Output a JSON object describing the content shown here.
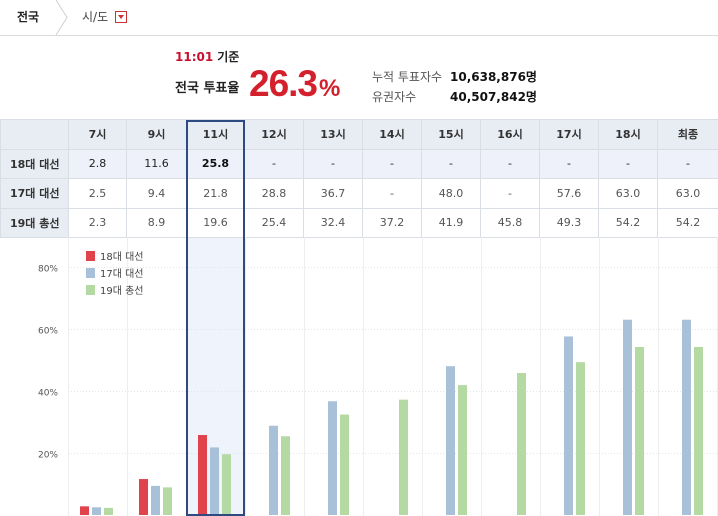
{
  "breadcrumb": {
    "national_label": "전국",
    "region_label": "시/도"
  },
  "summary": {
    "time": "11:01",
    "time_suffix": "기준",
    "turnout_label": "전국 투표율",
    "turnout_value": "26.3",
    "turnout_unit": "%",
    "cumulative_label": "누적 투표자수",
    "cumulative_value": "10,638,876명",
    "eligible_label": "유권자수",
    "eligible_value": "40,507,842명"
  },
  "table": {
    "columns": [
      "7시",
      "9시",
      "11시",
      "12시",
      "13시",
      "14시",
      "15시",
      "16시",
      "17시",
      "18시",
      "최종"
    ],
    "rows": [
      {
        "label": "18대 대선",
        "values": [
          "2.8",
          "11.6",
          "25.8",
          "-",
          "-",
          "-",
          "-",
          "-",
          "-",
          "-",
          "-"
        ]
      },
      {
        "label": "17대 대선",
        "values": [
          "2.5",
          "9.4",
          "21.8",
          "28.8",
          "36.7",
          "-",
          "48.0",
          "-",
          "57.6",
          "63.0",
          "63.0"
        ]
      },
      {
        "label": "19대 총선",
        "values": [
          "2.3",
          "8.9",
          "19.6",
          "25.4",
          "32.4",
          "37.2",
          "41.9",
          "45.8",
          "49.3",
          "54.2",
          "54.2"
        ]
      }
    ]
  },
  "chart_data": {
    "type": "bar",
    "categories": [
      "7시",
      "9시",
      "11시",
      "12시",
      "13시",
      "14시",
      "15시",
      "16시",
      "17시",
      "18시",
      "최종"
    ],
    "series": [
      {
        "name": "18대 대선",
        "color": "#e0434c",
        "values": [
          2.8,
          11.6,
          25.8,
          null,
          null,
          null,
          null,
          null,
          null,
          null,
          null
        ]
      },
      {
        "name": "17대 대선",
        "color": "#a9c0d9",
        "values": [
          2.5,
          9.4,
          21.8,
          28.8,
          36.7,
          null,
          48.0,
          null,
          57.6,
          63.0,
          63.0
        ]
      },
      {
        "name": "19대 총선",
        "color": "#b4d9a2",
        "values": [
          2.3,
          8.9,
          19.6,
          25.4,
          32.4,
          37.2,
          41.9,
          45.8,
          49.3,
          54.2,
          54.2
        ]
      }
    ],
    "yticks": [
      "20%",
      "40%",
      "60%",
      "80%"
    ],
    "ytick_values": [
      20,
      40,
      60,
      80
    ],
    "ylim": [
      0,
      90
    ],
    "legend_position": "top-left",
    "grid": true
  }
}
